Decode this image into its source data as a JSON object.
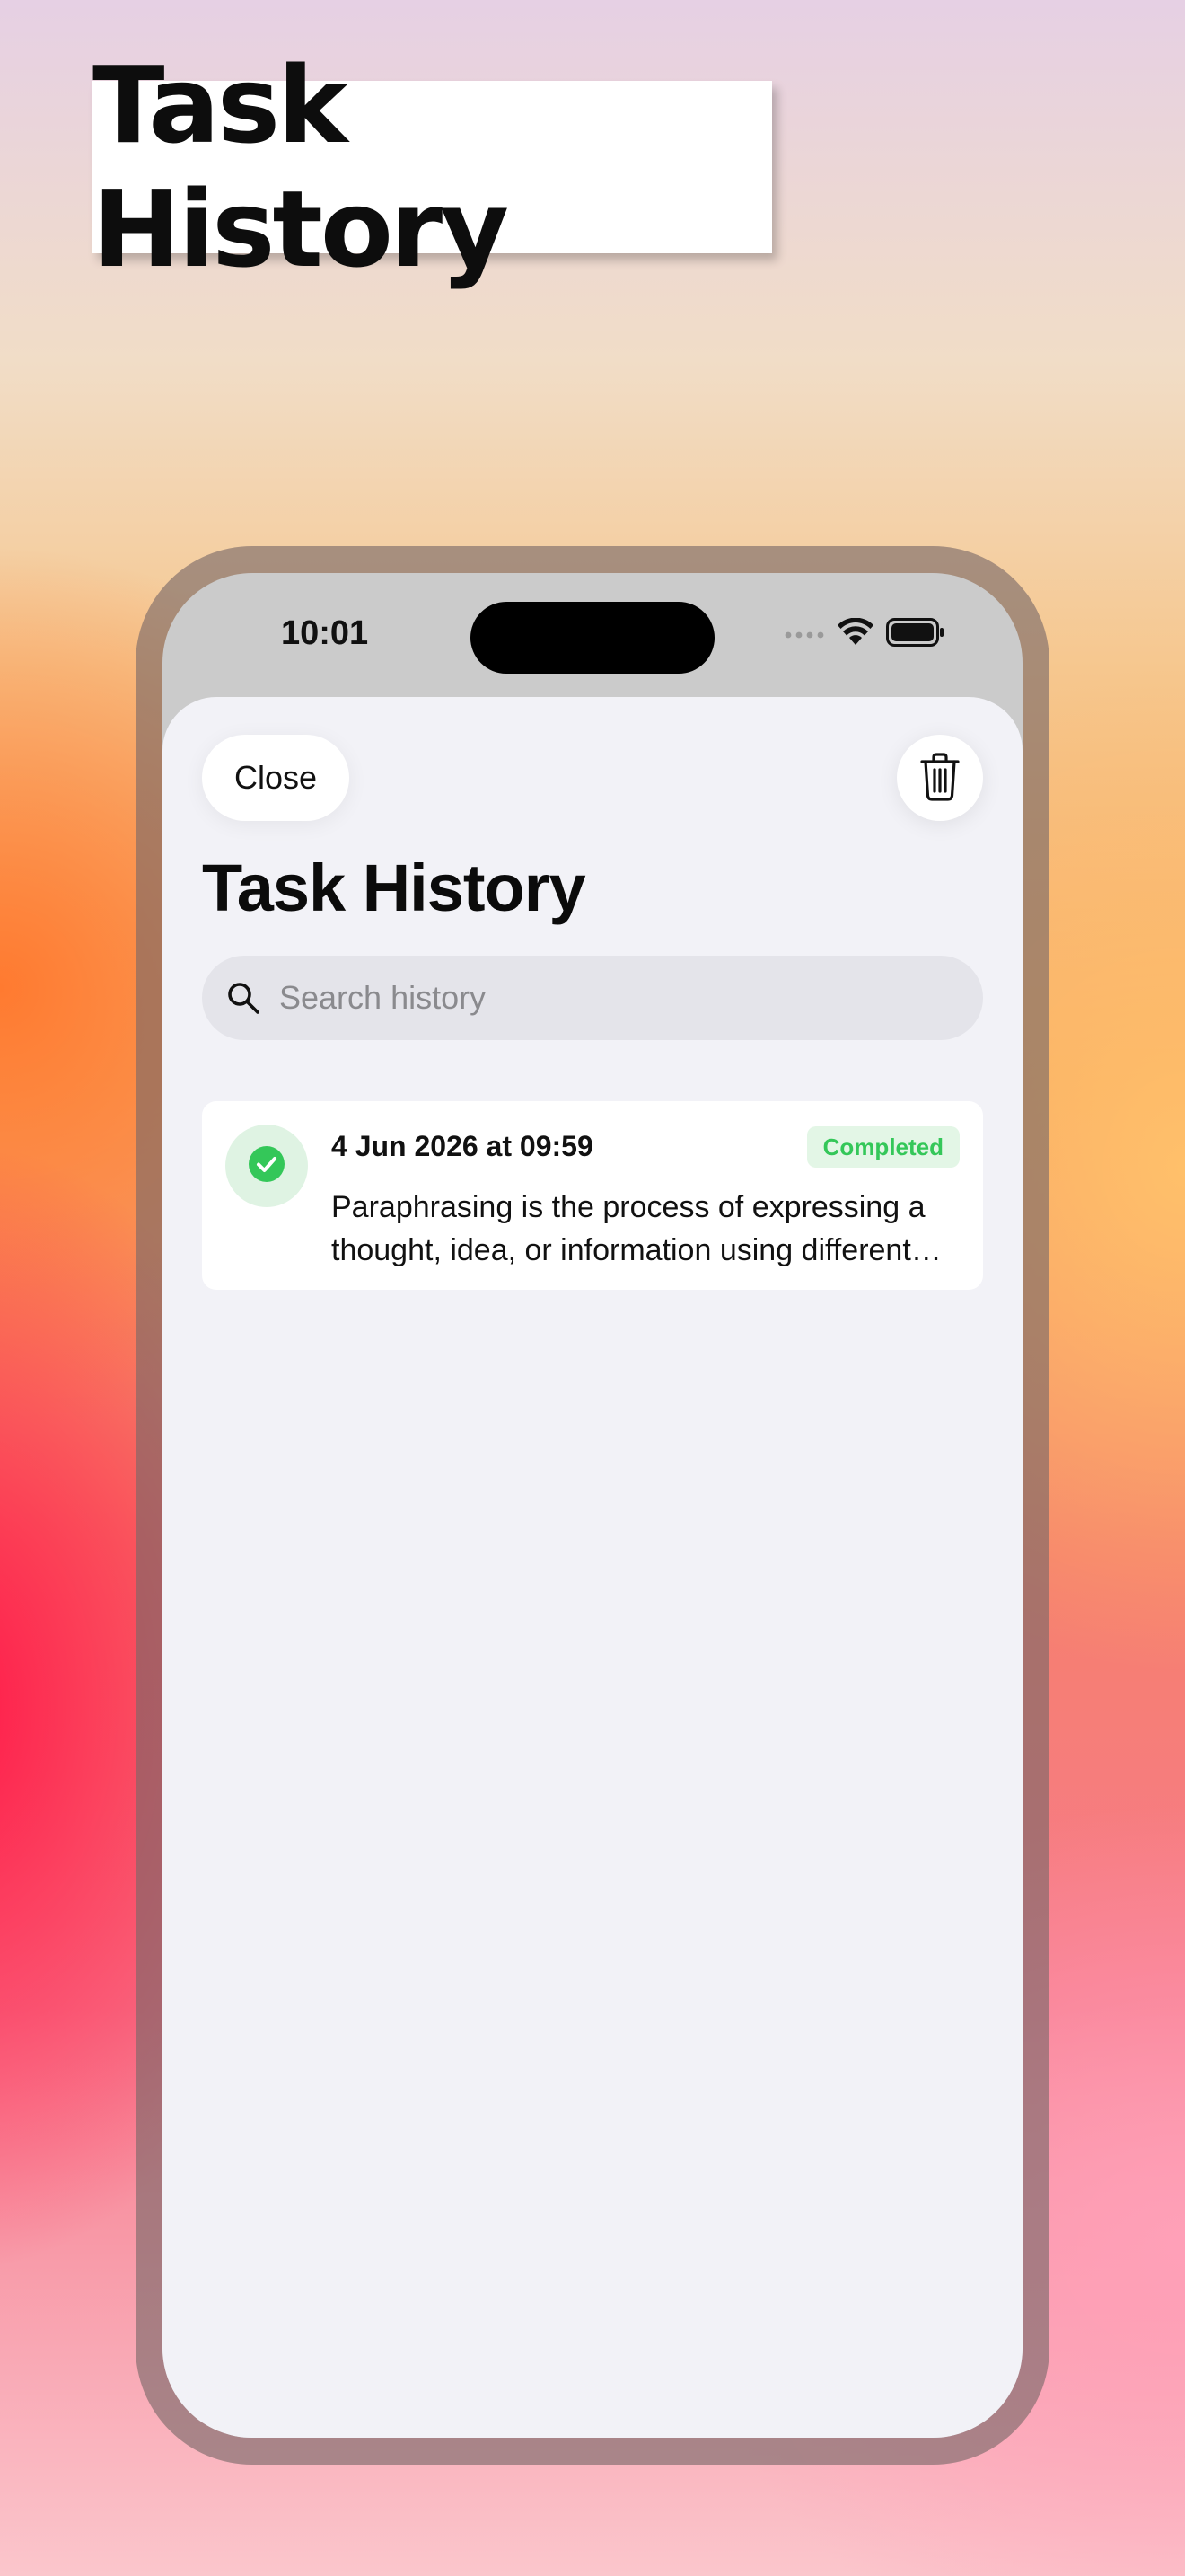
{
  "banner": {
    "title": "Task History"
  },
  "status_bar": {
    "time": "10:01"
  },
  "sheet": {
    "close_label": "Close",
    "title": "Task History",
    "search": {
      "placeholder": "Search history",
      "value": ""
    }
  },
  "history": [
    {
      "date": "4 Jun 2026 at 09:59",
      "status": "Completed",
      "preview": "Paraphrasing is the process of expressing a thought, idea, or information using different words"
    }
  ],
  "colors": {
    "success": "#34c759",
    "success_bg": "#e3f6e6",
    "sheet_bg": "#f2f2f7",
    "search_bg": "#e4e4ea"
  }
}
